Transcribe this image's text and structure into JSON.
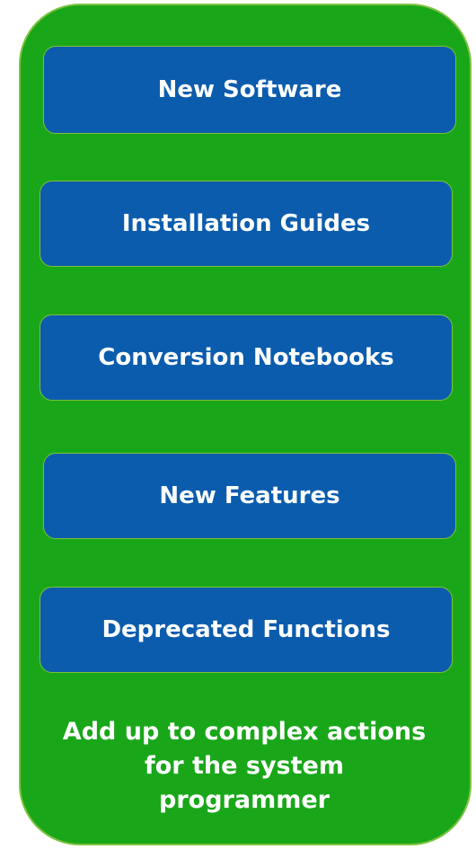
{
  "items": [
    {
      "label": "New Software"
    },
    {
      "label": "Installation Guides"
    },
    {
      "label": "Conversion Notebooks"
    },
    {
      "label": "New Features"
    },
    {
      "label": "Deprecated Functions"
    }
  ],
  "footer": {
    "line1": "Add up to complex actions",
    "line2": "for the system",
    "line3": "programmer"
  },
  "colors": {
    "panel": "#19a719",
    "box": "#0b5cad",
    "border": "#7fc241",
    "text": "#ffffff"
  }
}
